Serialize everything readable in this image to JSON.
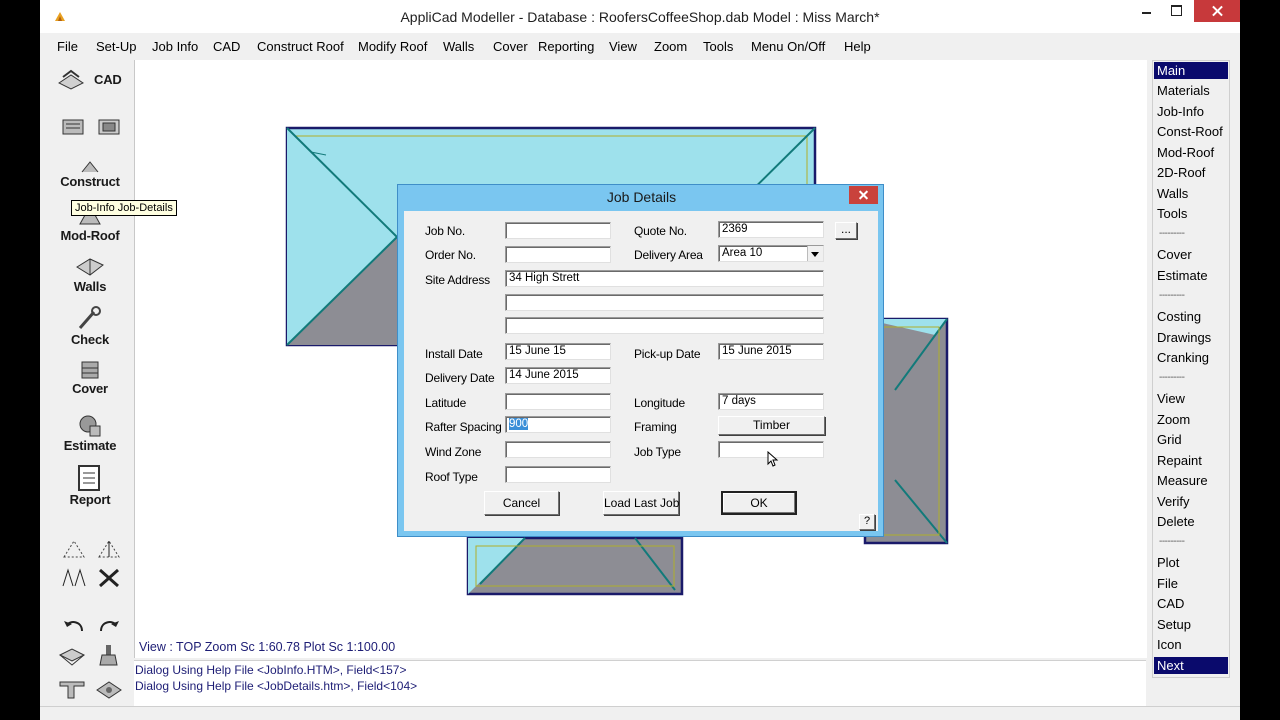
{
  "window": {
    "title": "AppliCad Modeller - Database : RoofersCoffeeShop.dab   Model : Miss March*"
  },
  "menubar": {
    "items": [
      "File",
      "Set-Up",
      "Job Info",
      "CAD",
      "Construct Roof",
      "Modify Roof",
      "Walls",
      "Cover",
      "Reporting",
      "View",
      "Zoom",
      "Tools",
      "Menu On/Off",
      "Help"
    ]
  },
  "toolbar": {
    "cad": "CAD",
    "construct": "Construct",
    "modroof": "Mod-Roof",
    "walls": "Walls",
    "check": "Check",
    "cover": "Cover",
    "estimate": "Estimate",
    "report": "Report",
    "tooltip": "Job-Info Job-Details"
  },
  "right_menu": {
    "items": [
      "Main",
      "Materials",
      "Job-Info",
      "Const-Roof",
      "Mod-Roof",
      "2D-Roof",
      "Walls",
      "Tools",
      "Cover",
      "Estimate",
      "Costing",
      "Drawings",
      "Cranking",
      "View",
      "Zoom",
      "Grid",
      "Repaint",
      "Measure",
      "Verify",
      "Delete",
      "Plot",
      "File",
      "CAD",
      "Setup",
      "Icon",
      "Next"
    ],
    "separator": "---------"
  },
  "status": {
    "view": "View : TOP  Zoom Sc 1:60.78  Plot Sc 1:100.00"
  },
  "log": {
    "lines": [
      "Dialog Using Help File <JobInfo.HTM>, Field<157>",
      "Dialog Using Help File <JobDetails.htm>, Field<104>"
    ]
  },
  "dialog": {
    "title": "Job Details",
    "labels": {
      "job_no": "Job No.",
      "quote_no": "Quote No.",
      "order_no": "Order No.",
      "delivery_area": "Delivery Area",
      "site_address": "Site Address",
      "install_date": "Install Date",
      "pickup_date": "Pick-up Date",
      "delivery_date": "Delivery Date",
      "latitude": "Latitude",
      "longitude": "Longitude",
      "rafter_spacing": "Rafter Spacing",
      "framing": "Framing",
      "wind_zone": "Wind Zone",
      "job_type": "Job Type",
      "roof_type": "Roof Type"
    },
    "values": {
      "job_no": "",
      "quote_no": "2369",
      "order_no": "",
      "delivery_area": "Area 10",
      "site_address_1": "34 High Strett",
      "site_address_2": "",
      "site_address_3": "",
      "install_date": "15 June 15",
      "pickup_date": "15 June 2015",
      "delivery_date": "14 June 2015",
      "latitude": "",
      "longitude": "7 days",
      "rafter_spacing": "900",
      "framing": "Timber",
      "wind_zone": "",
      "job_type": "",
      "roof_type": ""
    },
    "buttons": {
      "browse": "...",
      "cancel": "Cancel",
      "load_last": "Load Last Job",
      "ok": "OK",
      "help": "?"
    }
  }
}
